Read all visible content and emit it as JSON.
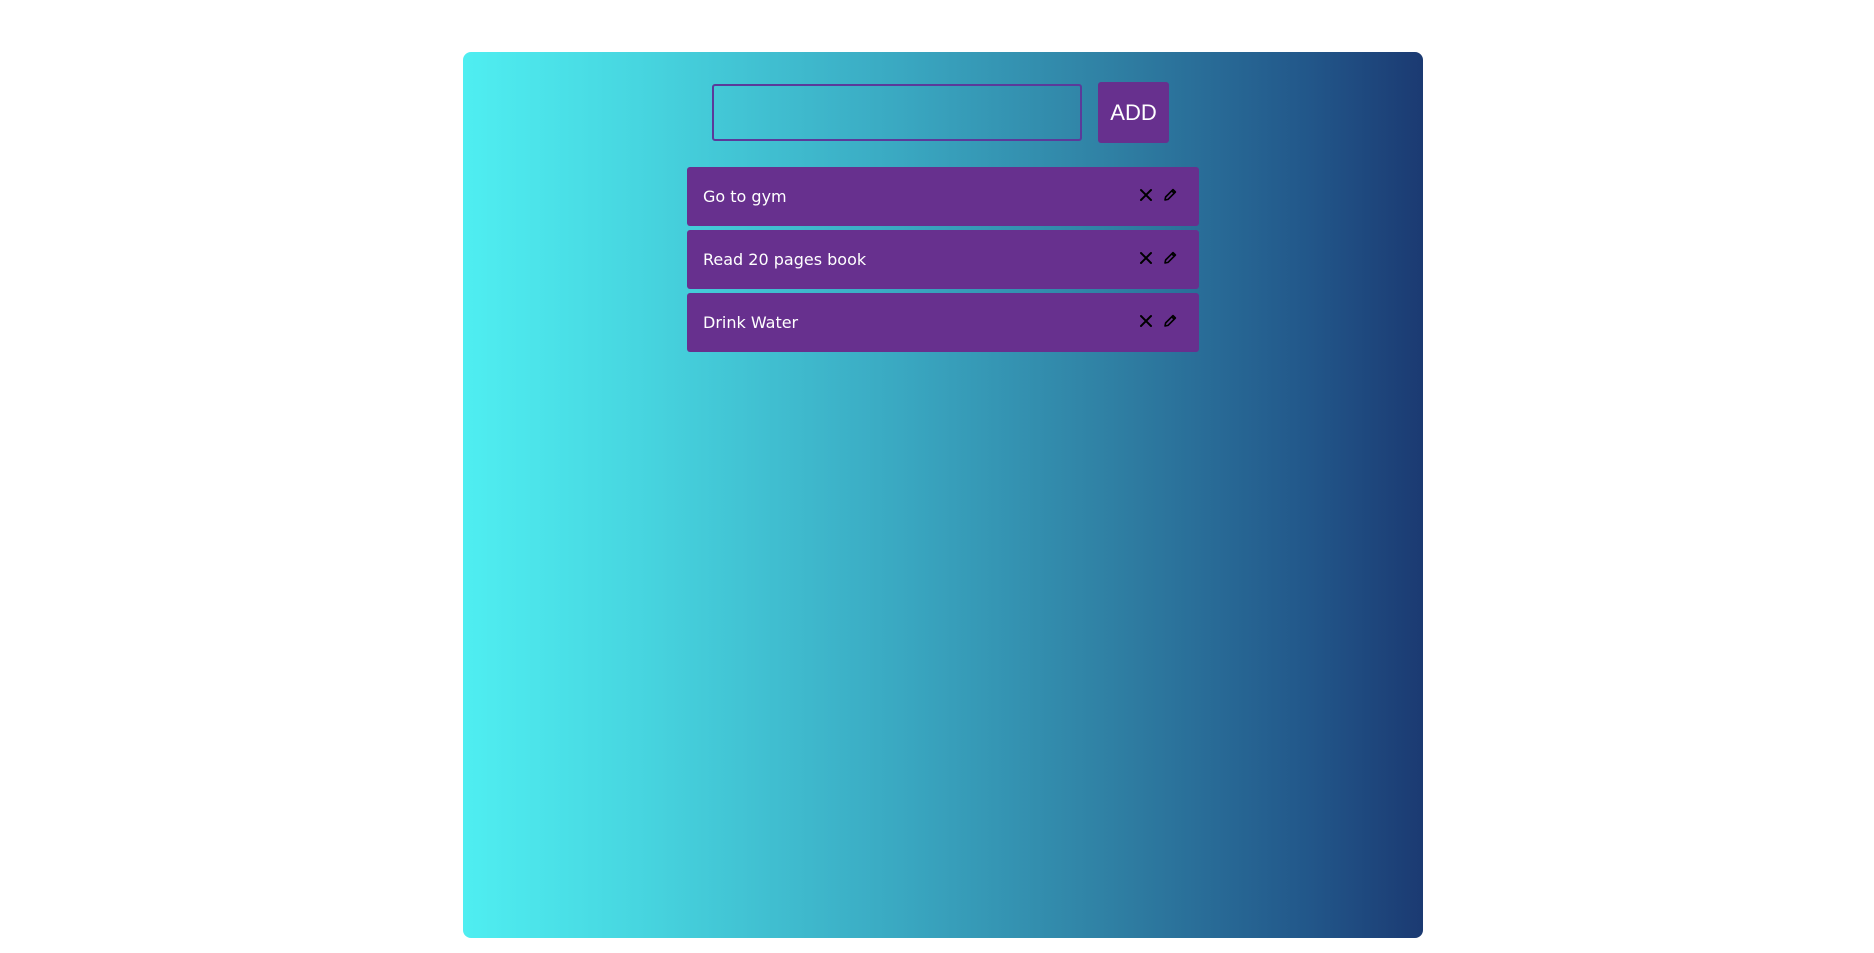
{
  "input": {
    "value": "",
    "placeholder": ""
  },
  "add_button": {
    "label": "ADD"
  },
  "todos": [
    {
      "text": "Go to gym",
      "delete_icon": "close-icon",
      "edit_icon": "pencil-icon"
    },
    {
      "text": "Read 20 pages book",
      "delete_icon": "close-icon",
      "edit_icon": "pencil-icon"
    },
    {
      "text": "Drink Water",
      "delete_icon": "close-icon",
      "edit_icon": "pencil-icon"
    }
  ],
  "colors": {
    "item_bg": "#67308e",
    "gradient_start": "#4feef1",
    "gradient_end": "#1b3a72"
  }
}
